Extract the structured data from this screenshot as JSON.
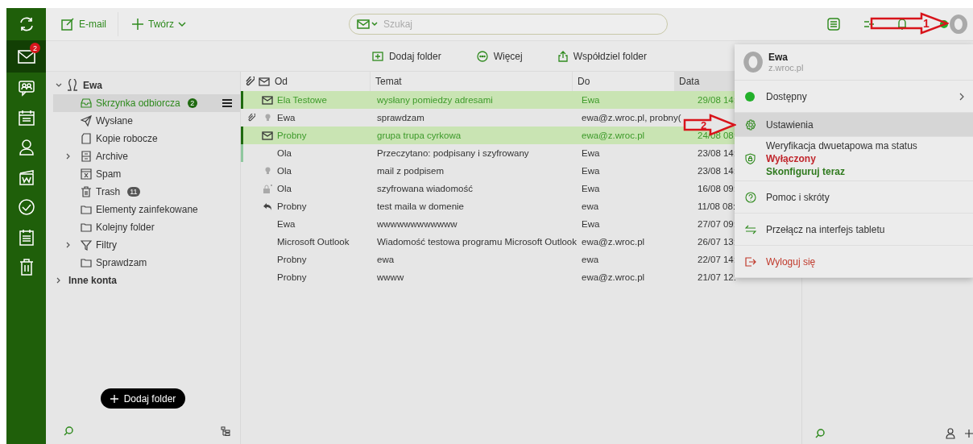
{
  "rail": [
    {
      "kind": "sync",
      "selected": false
    },
    {
      "kind": "mail",
      "selected": true,
      "badge": "2"
    },
    {
      "kind": "chat",
      "selected": false
    },
    {
      "kind": "calendar",
      "selected": false
    },
    {
      "kind": "person",
      "selected": false
    },
    {
      "kind": "docs",
      "selected": false
    },
    {
      "kind": "check",
      "selected": false
    },
    {
      "kind": "notes",
      "selected": false
    },
    {
      "kind": "trash",
      "selected": false
    }
  ],
  "topbar": {
    "buttons": [
      {
        "kind": "compose",
        "label": "E-mail"
      },
      {
        "kind": "create",
        "label": "Twórz"
      }
    ],
    "search": {
      "placeholder": "Szukaj"
    }
  },
  "toolbar": [
    {
      "kind": "add-folder",
      "label": "Dodaj folder"
    },
    {
      "kind": "more",
      "label": "Więcej"
    },
    {
      "kind": "share",
      "label": "Współdziel folder"
    }
  ],
  "folders": {
    "account": "Ewa",
    "expanded": true,
    "children": [
      {
        "kind": "inbox",
        "label": "Skrzynka odbiorcza",
        "selected": true,
        "count": "2"
      },
      {
        "kind": "sent",
        "label": "Wysłane",
        "selected": false
      },
      {
        "kind": "drafts",
        "label": "Kopie robocze",
        "selected": false
      },
      {
        "kind": "archive",
        "label": "Archive",
        "selected": false,
        "expanded": false
      },
      {
        "kind": "spam",
        "label": "Spam",
        "selected": false
      },
      {
        "kind": "trash",
        "label": "Trash",
        "selected": false,
        "count": "11"
      },
      {
        "kind": "folder",
        "label": "Elementy zainfekowane",
        "selected": false
      },
      {
        "kind": "folder",
        "label": "Kolejny folder",
        "selected": false
      },
      {
        "kind": "filter",
        "label": "Filtry",
        "selected": false,
        "expanded": false
      },
      {
        "kind": "folder",
        "label": "Sprawdzam",
        "selected": false
      }
    ],
    "other": {
      "label": "Inne konta",
      "expanded": false
    },
    "add_button": "Dodaj folder"
  },
  "messages": {
    "columns": [
      "Od",
      "Temat",
      "Do",
      "Data"
    ],
    "rows": [
      {
        "kind": "envelope",
        "from": "Ela Testowe",
        "subject": "wysłany pomiedzy adresami",
        "to": "Ewa",
        "date": "29/08 14:",
        "unread": true,
        "selected": false
      },
      {
        "kind": "bulb",
        "from": "Ewa",
        "subject": "sprawdzam",
        "to": "ewa@z.wroc.pl, probny(",
        "unread": false,
        "selected": false,
        "attachment": true
      },
      {
        "kind": "envelope",
        "from": "Probny",
        "subject": "grupa trupa cyrkowa",
        "to": "ewa@z.wroc.pl",
        "date": "24/08 08:",
        "unread": true,
        "selected": false
      },
      {
        "kind": "plain",
        "from": "Ola",
        "subject": "Przeczytano: podpisany i szyfrowany",
        "to": "Ewa",
        "date": "23/08 14:",
        "unread": false,
        "selected": true
      },
      {
        "kind": "bulb",
        "from": "Ola",
        "subject": "mail z podpisem",
        "to": "Ewa",
        "date": "23/08 14:",
        "unread": false,
        "selected": false
      },
      {
        "kind": "lock",
        "from": "Ola",
        "subject": "szyfrowana wiadomość",
        "to": "Ewa",
        "date": "16/08 09:",
        "unread": false,
        "selected": false
      },
      {
        "kind": "reply",
        "from": "Probny",
        "subject": "test maila w domenie",
        "to": "ewa",
        "date": "11/08 08:",
        "unread": false,
        "selected": false
      },
      {
        "kind": "plain",
        "from": "Ewa",
        "subject": "wwwwwwwwwwww",
        "to": "Ewa",
        "date": "27/07 09:",
        "unread": false,
        "selected": false
      },
      {
        "kind": "plain",
        "from": "Microsoft Outlook",
        "subject": "Wiadomość testowa programu Microsoft Outlook",
        "to": "ewa@z.wroc.pl",
        "date": "26/07 13:",
        "unread": false,
        "selected": false
      },
      {
        "kind": "plain",
        "from": "Probny",
        "subject": "ewa",
        "to": "ewa",
        "date": "22/07 14:",
        "unread": false,
        "selected": false
      },
      {
        "kind": "plain",
        "from": "Probny",
        "subject": "wwww",
        "to": "ewa@z.wroc.pl",
        "date": "21/07 12:",
        "unread": false,
        "selected": false
      }
    ]
  },
  "menu": {
    "name": "Ewa",
    "domain": "z.wroc.pl",
    "items": [
      {
        "kind": "status",
        "label": "Dostępny",
        "selected": false,
        "color": "#22b02a"
      },
      {
        "kind": "settings",
        "label": "Ustawienia",
        "selected": true
      },
      {
        "kind": "security",
        "label": "Weryfikacja dwuetapowa ma status **Wyłączony**",
        "link": "Skonfiguruj teraz",
        "selected": false
      },
      {
        "kind": "help",
        "label": "Pomoc i skróty",
        "selected": false
      },
      {
        "kind": "switch",
        "label": "Przełącz na interfejs tabletu",
        "selected": false
      },
      {
        "kind": "logout",
        "label": "Wyloguj się",
        "selected": false
      }
    ]
  },
  "annotations": [
    {
      "label": "1"
    },
    {
      "label": "2"
    }
  ]
}
